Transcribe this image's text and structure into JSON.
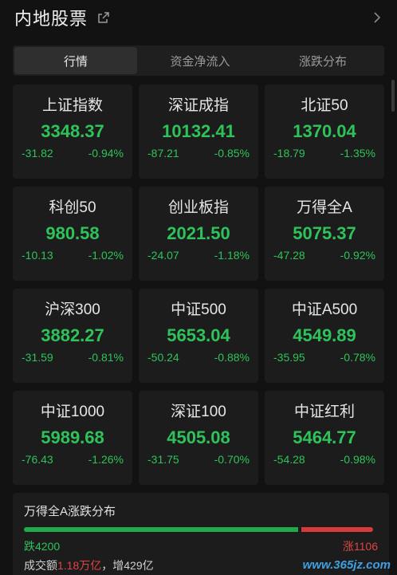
{
  "header": {
    "title": "内地股票"
  },
  "tabs": [
    {
      "label": "行情"
    },
    {
      "label": "资金净流入"
    },
    {
      "label": "涨跌分布"
    }
  ],
  "indices": [
    {
      "name": "上证指数",
      "value": "3348.37",
      "change": "-31.82",
      "pct": "-0.94%"
    },
    {
      "name": "深证成指",
      "value": "10132.41",
      "change": "-87.21",
      "pct": "-0.85%"
    },
    {
      "name": "北证50",
      "value": "1370.04",
      "change": "-18.79",
      "pct": "-1.35%"
    },
    {
      "name": "科创50",
      "value": "980.58",
      "change": "-10.13",
      "pct": "-1.02%"
    },
    {
      "name": "创业板指",
      "value": "2021.50",
      "change": "-24.07",
      "pct": "-1.18%"
    },
    {
      "name": "万得全A",
      "value": "5075.37",
      "change": "-47.28",
      "pct": "-0.92%"
    },
    {
      "name": "沪深300",
      "value": "3882.27",
      "change": "-31.59",
      "pct": "-0.81%"
    },
    {
      "name": "中证500",
      "value": "5653.04",
      "change": "-50.24",
      "pct": "-0.88%"
    },
    {
      "name": "中证A500",
      "value": "4549.89",
      "change": "-35.95",
      "pct": "-0.78%"
    },
    {
      "name": "中证1000",
      "value": "5989.68",
      "change": "-76.43",
      "pct": "-1.26%"
    },
    {
      "name": "深证100",
      "value": "4505.08",
      "change": "-31.75",
      "pct": "-0.70%"
    },
    {
      "name": "中证红利",
      "value": "5464.77",
      "change": "-54.28",
      "pct": "-0.98%"
    }
  ],
  "distribution": {
    "title": "万得全A涨跌分布",
    "fall_label": "跌4200",
    "rise_label": "涨1106",
    "fall_count": 4200,
    "rise_count": 1106,
    "turnover_prefix": "成交额",
    "turnover_value": "1.18万亿",
    "turnover_sep": "，",
    "turnover_increase": "增429亿"
  },
  "watermark": "www.365jz.com",
  "colors": {
    "down": "#2ec35a",
    "up": "#e04444",
    "background": "#121212"
  }
}
